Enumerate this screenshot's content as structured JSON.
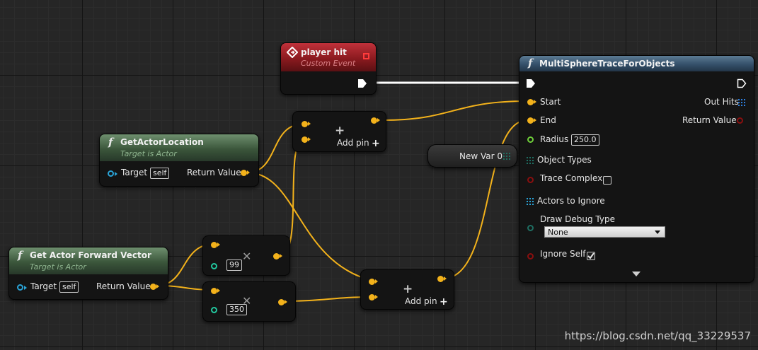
{
  "nodes": {
    "player_hit": {
      "title": "player hit",
      "subtitle": "Custom Event"
    },
    "get_actor_location": {
      "title": "GetActorLocation",
      "subtitle": "Target is Actor",
      "target_label": "Target",
      "target_value": "self",
      "return_label": "Return Value"
    },
    "get_actor_forward_vector": {
      "title": "Get Actor Forward Vector",
      "subtitle": "Target is Actor",
      "target_label": "Target",
      "target_value": "self",
      "return_label": "Return Value"
    },
    "add_top": {
      "add_pin_label": "Add pin"
    },
    "add_bottom": {
      "add_pin_label": "Add pin"
    },
    "multiply_99": {
      "value": "99"
    },
    "multiply_350": {
      "value": "350"
    },
    "new_var": {
      "label": "New Var 0"
    },
    "multi_sphere_trace": {
      "title": "MultiSphereTraceForObjects",
      "pins_in": {
        "start": "Start",
        "end": "End",
        "radius": "Radius",
        "radius_value": "250.0",
        "object_types": "Object Types",
        "trace_complex": "Trace Complex",
        "actors_to_ignore": "Actors to Ignore",
        "draw_debug_type": "Draw Debug Type",
        "draw_debug_value": "None",
        "ignore_self": "Ignore Self"
      },
      "pins_out": {
        "out_hits": "Out Hits",
        "return_value": "Return Value"
      },
      "trace_complex_checked": false,
      "ignore_self_checked": true
    }
  },
  "watermark": "https://blog.csdn.net/qq_33229537",
  "colors": {
    "vector_wire": "#f3b21b",
    "exec_wire": "#ffffff",
    "object_pin": "#2aa4d8",
    "float_pin": "#6fcf3a",
    "bool_pin": "#8a0f0f",
    "byte_pin": "#1f6e62",
    "int_pin": "#22c9a0"
  }
}
